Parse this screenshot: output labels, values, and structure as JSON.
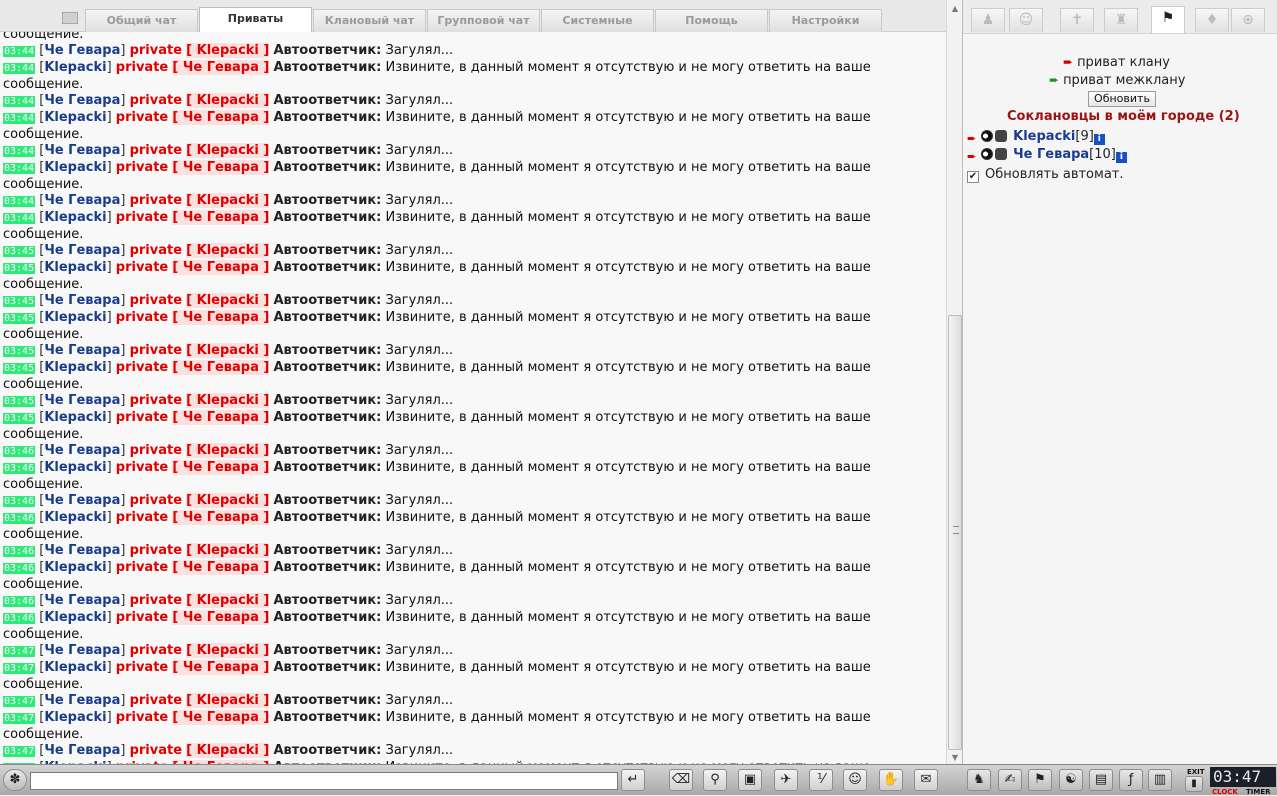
{
  "tabs": [
    "Общий чат",
    "Приваты",
    "Клановый чат",
    "Групповой чат",
    "Системные",
    "Помощь",
    "Настройки"
  ],
  "active_tab": "Приваты",
  "chat": {
    "top_partial": "сообщение.",
    "labels": {
      "private": "private",
      "bot": "Автоответчик:"
    },
    "messages": [
      {
        "time": "03:44",
        "from": "Че Гевара",
        "to": "Klepacki",
        "text": "Загулял..."
      },
      {
        "time": "03:44",
        "from": "Klepacki",
        "to": "Че Гевара",
        "text": "Извините, в данный момент я отсутствую и не могу ответить на ваше сообщение."
      },
      {
        "time": "03:44",
        "from": "Че Гевара",
        "to": "Klepacki",
        "text": "Загулял..."
      },
      {
        "time": "03:44",
        "from": "Klepacki",
        "to": "Че Гевара",
        "text": "Извините, в данный момент я отсутствую и не могу ответить на ваше сообщение."
      },
      {
        "time": "03:44",
        "from": "Че Гевара",
        "to": "Klepacki",
        "text": "Загулял..."
      },
      {
        "time": "03:44",
        "from": "Klepacki",
        "to": "Че Гевара",
        "text": "Извините, в данный момент я отсутствую и не могу ответить на ваше сообщение."
      },
      {
        "time": "03:44",
        "from": "Че Гевара",
        "to": "Klepacki",
        "text": "Загулял..."
      },
      {
        "time": "03:44",
        "from": "Klepacki",
        "to": "Че Гевара",
        "text": "Извините, в данный момент я отсутствую и не могу ответить на ваше сообщение."
      },
      {
        "time": "03:45",
        "from": "Че Гевара",
        "to": "Klepacki",
        "text": "Загулял..."
      },
      {
        "time": "03:45",
        "from": "Klepacki",
        "to": "Че Гевара",
        "text": "Извините, в данный момент я отсутствую и не могу ответить на ваше сообщение."
      },
      {
        "time": "03:45",
        "from": "Че Гевара",
        "to": "Klepacki",
        "text": "Загулял..."
      },
      {
        "time": "03:45",
        "from": "Klepacki",
        "to": "Че Гевара",
        "text": "Извините, в данный момент я отсутствую и не могу ответить на ваше сообщение."
      },
      {
        "time": "03:45",
        "from": "Че Гевара",
        "to": "Klepacki",
        "text": "Загулял..."
      },
      {
        "time": "03:45",
        "from": "Klepacki",
        "to": "Че Гевара",
        "text": "Извините, в данный момент я отсутствую и не могу ответить на ваше сообщение."
      },
      {
        "time": "03:45",
        "from": "Че Гевара",
        "to": "Klepacki",
        "text": "Загулял..."
      },
      {
        "time": "03:45",
        "from": "Klepacki",
        "to": "Че Гевара",
        "text": "Извините, в данный момент я отсутствую и не могу ответить на ваше сообщение."
      },
      {
        "time": "03:46",
        "from": "Че Гевара",
        "to": "Klepacki",
        "text": "Загулял..."
      },
      {
        "time": "03:46",
        "from": "Klepacki",
        "to": "Че Гевара",
        "text": "Извините, в данный момент я отсутствую и не могу ответить на ваше сообщение."
      },
      {
        "time": "03:46",
        "from": "Че Гевара",
        "to": "Klepacki",
        "text": "Загулял..."
      },
      {
        "time": "03:46",
        "from": "Klepacki",
        "to": "Че Гевара",
        "text": "Извините, в данный момент я отсутствую и не могу ответить на ваше сообщение."
      },
      {
        "time": "03:46",
        "from": "Че Гевара",
        "to": "Klepacki",
        "text": "Загулял..."
      },
      {
        "time": "03:46",
        "from": "Klepacki",
        "to": "Че Гевара",
        "text": "Извините, в данный момент я отсутствую и не могу ответить на ваше сообщение."
      },
      {
        "time": "03:46",
        "from": "Че Гевара",
        "to": "Klepacki",
        "text": "Загулял..."
      },
      {
        "time": "03:46",
        "from": "Klepacki",
        "to": "Че Гевара",
        "text": "Извините, в данный момент я отсутствую и не могу ответить на ваше сообщение."
      },
      {
        "time": "03:47",
        "from": "Че Гевара",
        "to": "Klepacki",
        "text": "Загулял..."
      },
      {
        "time": "03:47",
        "from": "Klepacki",
        "to": "Че Гевара",
        "text": "Извините, в данный момент я отсутствую и не могу ответить на ваше сообщение."
      },
      {
        "time": "03:47",
        "from": "Че Гевара",
        "to": "Klepacki",
        "text": "Загулял..."
      },
      {
        "time": "03:47",
        "from": "Klepacki",
        "to": "Че Гевара",
        "text": "Извините, в данный момент я отсутствую и не могу ответить на ваше сообщение."
      },
      {
        "time": "03:47",
        "from": "Че Гевара",
        "to": "Klepacki",
        "text": "Загулял..."
      },
      {
        "time": "03:47",
        "from": "Klepacki",
        "to": "Че Гевара",
        "text": "Извините, в данный момент я отсутствую и не могу ответить на ваше сообщение."
      }
    ]
  },
  "right_panel": {
    "tab_icons": [
      "person-icon",
      "smile-icon",
      "cross-icon",
      "group-icon",
      "flag-icon",
      "diamond-icon",
      "globe-icon"
    ],
    "active_tab_index": 4,
    "private_clan": "приват клану",
    "private_interclan": "приват межклану",
    "refresh_label": "Обновить",
    "clan_title": "Соклановцы в моём городе (2)",
    "members": [
      {
        "name": "Klepacki",
        "level": "[9]",
        "info": "i"
      },
      {
        "name": "Че Гевара",
        "level": "[10]",
        "info": "i"
      }
    ],
    "auto_refresh_label": "Обновлять автомат.",
    "auto_refresh_checked": true
  },
  "bottom": {
    "input_value": "",
    "exit_label": "EXIT",
    "clock_time": "03:47",
    "clock_label": "CLOCK",
    "timer_label": "TIMER"
  },
  "colors": {
    "timestamp": "#2eea79",
    "nick": "#1a3c8c",
    "private": "#e00000",
    "clan_title": "#9b1414"
  }
}
